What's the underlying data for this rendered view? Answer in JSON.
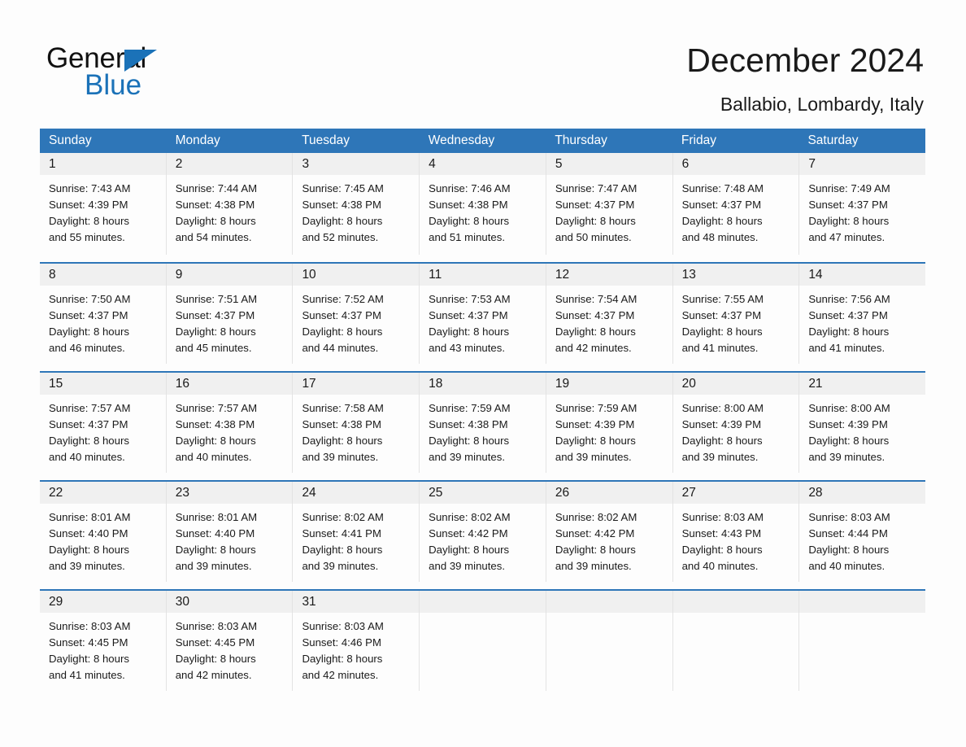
{
  "brand": {
    "name_top": "General",
    "name_bottom": "Blue",
    "triangle_color": "#1b72b8",
    "text_color": "#111111"
  },
  "header": {
    "title": "December 2024",
    "subtitle": "Ballabio, Lombardy, Italy"
  },
  "theme": {
    "header_blue": "#2e76b8",
    "daynum_band": "#f0f0f0",
    "page_background": "#fdfdfd",
    "text": "#1a1a1a"
  },
  "calendar": {
    "day_headers": [
      "Sunday",
      "Monday",
      "Tuesday",
      "Wednesday",
      "Thursday",
      "Friday",
      "Saturday"
    ],
    "weeks": [
      [
        {
          "day": "1",
          "sunrise": "Sunrise: 7:43 AM",
          "sunset": "Sunset: 4:39 PM",
          "daylight_1": "Daylight: 8 hours",
          "daylight_2": "and 55 minutes."
        },
        {
          "day": "2",
          "sunrise": "Sunrise: 7:44 AM",
          "sunset": "Sunset: 4:38 PM",
          "daylight_1": "Daylight: 8 hours",
          "daylight_2": "and 54 minutes."
        },
        {
          "day": "3",
          "sunrise": "Sunrise: 7:45 AM",
          "sunset": "Sunset: 4:38 PM",
          "daylight_1": "Daylight: 8 hours",
          "daylight_2": "and 52 minutes."
        },
        {
          "day": "4",
          "sunrise": "Sunrise: 7:46 AM",
          "sunset": "Sunset: 4:38 PM",
          "daylight_1": "Daylight: 8 hours",
          "daylight_2": "and 51 minutes."
        },
        {
          "day": "5",
          "sunrise": "Sunrise: 7:47 AM",
          "sunset": "Sunset: 4:37 PM",
          "daylight_1": "Daylight: 8 hours",
          "daylight_2": "and 50 minutes."
        },
        {
          "day": "6",
          "sunrise": "Sunrise: 7:48 AM",
          "sunset": "Sunset: 4:37 PM",
          "daylight_1": "Daylight: 8 hours",
          "daylight_2": "and 48 minutes."
        },
        {
          "day": "7",
          "sunrise": "Sunrise: 7:49 AM",
          "sunset": "Sunset: 4:37 PM",
          "daylight_1": "Daylight: 8 hours",
          "daylight_2": "and 47 minutes."
        }
      ],
      [
        {
          "day": "8",
          "sunrise": "Sunrise: 7:50 AM",
          "sunset": "Sunset: 4:37 PM",
          "daylight_1": "Daylight: 8 hours",
          "daylight_2": "and 46 minutes."
        },
        {
          "day": "9",
          "sunrise": "Sunrise: 7:51 AM",
          "sunset": "Sunset: 4:37 PM",
          "daylight_1": "Daylight: 8 hours",
          "daylight_2": "and 45 minutes."
        },
        {
          "day": "10",
          "sunrise": "Sunrise: 7:52 AM",
          "sunset": "Sunset: 4:37 PM",
          "daylight_1": "Daylight: 8 hours",
          "daylight_2": "and 44 minutes."
        },
        {
          "day": "11",
          "sunrise": "Sunrise: 7:53 AM",
          "sunset": "Sunset: 4:37 PM",
          "daylight_1": "Daylight: 8 hours",
          "daylight_2": "and 43 minutes."
        },
        {
          "day": "12",
          "sunrise": "Sunrise: 7:54 AM",
          "sunset": "Sunset: 4:37 PM",
          "daylight_1": "Daylight: 8 hours",
          "daylight_2": "and 42 minutes."
        },
        {
          "day": "13",
          "sunrise": "Sunrise: 7:55 AM",
          "sunset": "Sunset: 4:37 PM",
          "daylight_1": "Daylight: 8 hours",
          "daylight_2": "and 41 minutes."
        },
        {
          "day": "14",
          "sunrise": "Sunrise: 7:56 AM",
          "sunset": "Sunset: 4:37 PM",
          "daylight_1": "Daylight: 8 hours",
          "daylight_2": "and 41 minutes."
        }
      ],
      [
        {
          "day": "15",
          "sunrise": "Sunrise: 7:57 AM",
          "sunset": "Sunset: 4:37 PM",
          "daylight_1": "Daylight: 8 hours",
          "daylight_2": "and 40 minutes."
        },
        {
          "day": "16",
          "sunrise": "Sunrise: 7:57 AM",
          "sunset": "Sunset: 4:38 PM",
          "daylight_1": "Daylight: 8 hours",
          "daylight_2": "and 40 minutes."
        },
        {
          "day": "17",
          "sunrise": "Sunrise: 7:58 AM",
          "sunset": "Sunset: 4:38 PM",
          "daylight_1": "Daylight: 8 hours",
          "daylight_2": "and 39 minutes."
        },
        {
          "day": "18",
          "sunrise": "Sunrise: 7:59 AM",
          "sunset": "Sunset: 4:38 PM",
          "daylight_1": "Daylight: 8 hours",
          "daylight_2": "and 39 minutes."
        },
        {
          "day": "19",
          "sunrise": "Sunrise: 7:59 AM",
          "sunset": "Sunset: 4:39 PM",
          "daylight_1": "Daylight: 8 hours",
          "daylight_2": "and 39 minutes."
        },
        {
          "day": "20",
          "sunrise": "Sunrise: 8:00 AM",
          "sunset": "Sunset: 4:39 PM",
          "daylight_1": "Daylight: 8 hours",
          "daylight_2": "and 39 minutes."
        },
        {
          "day": "21",
          "sunrise": "Sunrise: 8:00 AM",
          "sunset": "Sunset: 4:39 PM",
          "daylight_1": "Daylight: 8 hours",
          "daylight_2": "and 39 minutes."
        }
      ],
      [
        {
          "day": "22",
          "sunrise": "Sunrise: 8:01 AM",
          "sunset": "Sunset: 4:40 PM",
          "daylight_1": "Daylight: 8 hours",
          "daylight_2": "and 39 minutes."
        },
        {
          "day": "23",
          "sunrise": "Sunrise: 8:01 AM",
          "sunset": "Sunset: 4:40 PM",
          "daylight_1": "Daylight: 8 hours",
          "daylight_2": "and 39 minutes."
        },
        {
          "day": "24",
          "sunrise": "Sunrise: 8:02 AM",
          "sunset": "Sunset: 4:41 PM",
          "daylight_1": "Daylight: 8 hours",
          "daylight_2": "and 39 minutes."
        },
        {
          "day": "25",
          "sunrise": "Sunrise: 8:02 AM",
          "sunset": "Sunset: 4:42 PM",
          "daylight_1": "Daylight: 8 hours",
          "daylight_2": "and 39 minutes."
        },
        {
          "day": "26",
          "sunrise": "Sunrise: 8:02 AM",
          "sunset": "Sunset: 4:42 PM",
          "daylight_1": "Daylight: 8 hours",
          "daylight_2": "and 39 minutes."
        },
        {
          "day": "27",
          "sunrise": "Sunrise: 8:03 AM",
          "sunset": "Sunset: 4:43 PM",
          "daylight_1": "Daylight: 8 hours",
          "daylight_2": "and 40 minutes."
        },
        {
          "day": "28",
          "sunrise": "Sunrise: 8:03 AM",
          "sunset": "Sunset: 4:44 PM",
          "daylight_1": "Daylight: 8 hours",
          "daylight_2": "and 40 minutes."
        }
      ],
      [
        {
          "day": "29",
          "sunrise": "Sunrise: 8:03 AM",
          "sunset": "Sunset: 4:45 PM",
          "daylight_1": "Daylight: 8 hours",
          "daylight_2": "and 41 minutes."
        },
        {
          "day": "30",
          "sunrise": "Sunrise: 8:03 AM",
          "sunset": "Sunset: 4:45 PM",
          "daylight_1": "Daylight: 8 hours",
          "daylight_2": "and 42 minutes."
        },
        {
          "day": "31",
          "sunrise": "Sunrise: 8:03 AM",
          "sunset": "Sunset: 4:46 PM",
          "daylight_1": "Daylight: 8 hours",
          "daylight_2": "and 42 minutes."
        },
        {
          "day": "",
          "sunrise": "",
          "sunset": "",
          "daylight_1": "",
          "daylight_2": ""
        },
        {
          "day": "",
          "sunrise": "",
          "sunset": "",
          "daylight_1": "",
          "daylight_2": ""
        },
        {
          "day": "",
          "sunrise": "",
          "sunset": "",
          "daylight_1": "",
          "daylight_2": ""
        },
        {
          "day": "",
          "sunrise": "",
          "sunset": "",
          "daylight_1": "",
          "daylight_2": ""
        }
      ]
    ]
  }
}
